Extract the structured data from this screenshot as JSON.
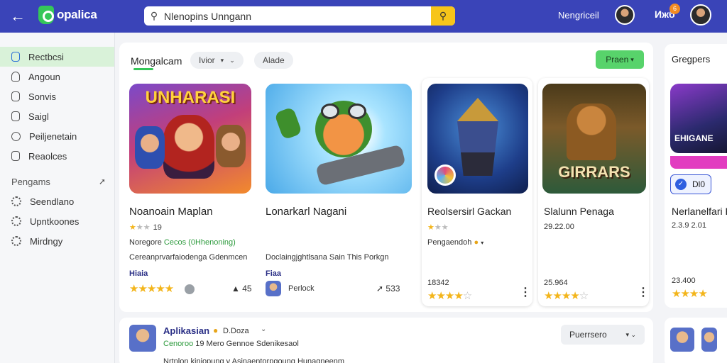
{
  "header": {
    "logo_text": "opalica",
    "search_value": "Nlenopins Unngann",
    "user_name": "Nengriceil",
    "notif_text": "Ижб",
    "notif_count": "6"
  },
  "sidebar": {
    "items": [
      {
        "label": "Rectbcsi"
      },
      {
        "label": "Angoun"
      },
      {
        "label": "Sonvis"
      },
      {
        "label": "Saigl"
      },
      {
        "label": "Peiljenetain"
      },
      {
        "label": "Reaolces"
      }
    ],
    "section_label": "Pengams",
    "sub_items": [
      {
        "label": "Seendlano"
      },
      {
        "label": "Upntkoones"
      },
      {
        "label": "Mirdngy"
      }
    ]
  },
  "main": {
    "section_title": "Mongalcam",
    "filter1": "Ivior",
    "filter2": "Alade",
    "green_button": "Praen",
    "cards": [
      {
        "banner": "UNHARASI",
        "title": "Noanoain Maplan",
        "rating": "19",
        "developer_prefix": "Noregore",
        "developer_highlight": "Cecos (0Hhenoning)",
        "description": "Cereanprvarfaiodenga Gdenmcen",
        "tag": "Hiaia",
        "metric": "45"
      },
      {
        "title": "Lonarkarl Nagani",
        "description": "Doclaingjghtlsana Sain This Porkgn",
        "tag": "Fiaa",
        "developer": "Perlock",
        "metric": "533"
      },
      {
        "title": "Reolsersirl Gackan",
        "developer": "Pengaendoh",
        "metric": "18342"
      },
      {
        "banner": "GIRRARS",
        "title": "Slalunn Penaga",
        "subtitle": "29.22.00",
        "metric": "25.964"
      }
    ]
  },
  "side_card": {
    "title": "Gregpers",
    "art_banner": "EHIGANE",
    "card_title": "Nerlanelfari P",
    "subtitle": "2.3.9 2.01",
    "rank_label": "Dl0",
    "metric": "23.400"
  },
  "bottom": {
    "title": "Aplikasian",
    "badge": "D.Doza",
    "line1_green": "Cenoroo",
    "line1_rest": "19 Mero Gennoe Sdenikesaol",
    "line2": "Nrtnlon kiniopung v Asinaentorpgoung Hunagneenm",
    "sort_label": "Puerrsero"
  }
}
